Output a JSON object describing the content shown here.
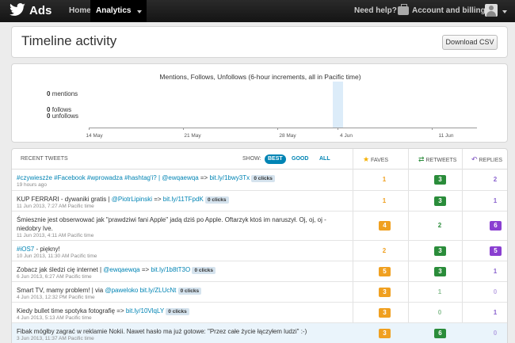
{
  "topbar": {
    "brand": "Ads",
    "nav_home": "Home",
    "nav_analytics": "Analytics",
    "nav_help": "Need help?",
    "nav_account": "Account and billing"
  },
  "header": {
    "title": "Timeline activity",
    "download_label": "Download CSV"
  },
  "chart": {
    "title": "Mentions, Follows, Unfollows (6-hour increments, all in Pacific time)",
    "mentions_count": "0",
    "mentions_label": "mentions",
    "follows_count": "0",
    "follows_label": "follows",
    "unfollows_count": "0",
    "unfollows_label": "unfollows",
    "dates": [
      "14 May",
      "21 May",
      "28 May",
      "4 Jun",
      "11 Jun"
    ]
  },
  "chart_data": {
    "type": "line",
    "title": "Mentions, Follows, Unfollows (6-hour increments, all in Pacific time)",
    "x_ticks": [
      "14 May",
      "21 May",
      "28 May",
      "4 Jun",
      "11 Jun"
    ],
    "series": [
      {
        "name": "mentions",
        "total": 0
      },
      {
        "name": "follows",
        "total": 0
      },
      {
        "name": "unfollows",
        "total": 0
      }
    ],
    "highlighted_range": [
      "3 Jun",
      "4 Jun"
    ]
  },
  "table": {
    "recent_label": "RECENT TWEETS",
    "show_label": "SHOW:",
    "filter_best": "BEST",
    "filter_good": "GOOD",
    "filter_all": "ALL",
    "faves_label": "FAVES",
    "retweets_label": "RETWEETS",
    "replies_label": "REPLIES",
    "rows": [
      {
        "text": "#czywieszże #Facebook #wprowadza #hashtag'i? | ",
        "mention": "@ewqaewqa",
        "arrow": " => ",
        "link": "bit.ly/1bwy3Tx",
        "clicks": "0 clicks",
        "time": "19 hours ago",
        "faves": "1",
        "retweets": "3",
        "replies": "2"
      },
      {
        "text": "KUP FERRARI - dywaniki gratis | ",
        "mention": "@PiotrLipinski",
        "arrow": " => ",
        "link": "bit.ly/11TFpdK",
        "clicks": "0 clicks",
        "time": "11 Jun 2013, 7:27 AM Pacific time",
        "faves": "1",
        "retweets": "3",
        "replies": "1"
      },
      {
        "text": "Śmiesznie jest obserwować jak \"prawdziwi fani Apple\" jadą dziś po Apple. Oftarzyk ktoś im naruszył. Oj, oj, oj - niedobry Ive.",
        "time": "11 Jun 2013, 4:11 AM Pacific time",
        "faves": "4",
        "retweets": "2",
        "replies": "6"
      },
      {
        "text": "",
        "link": "#iOS7",
        "suffix": " - piękny!",
        "time": "10 Jun 2013, 11:30 AM Pacific time",
        "faves": "2",
        "retweets": "3",
        "replies": "5"
      },
      {
        "text": "Zobacz jak śledzi cię internet | ",
        "mention": "@ewqaewqa",
        "arrow": " => ",
        "link": "bit.ly/1b8tT3O",
        "clicks": "0 clicks",
        "time": "6 Jun 2013, 6:27 AM Pacific time",
        "faves": "5",
        "retweets": "3",
        "replies": "1"
      },
      {
        "text": "Smart TV, mamy problem! | via ",
        "mention": "@paweloko",
        "arrow": " ",
        "link": "bit.ly/ZLUcNt",
        "clicks": "0 clicks",
        "time": "4 Jun 2013, 12:32 PM Pacific time",
        "faves": "3",
        "retweets": "1",
        "replies": "0"
      },
      {
        "text": "Kiedy bullet time spotyka fotografię => ",
        "link": "bit.ly/10VlqLY",
        "clicks": "0 clicks",
        "time": "4 Jun 2013, 5:13 AM Pacific time",
        "faves": "3",
        "retweets": "0",
        "replies": "1"
      },
      {
        "text": "Fibak mógłby zagrać w reklamie Nokii. Nawet hasło ma już gotowe: \"Przez całe życie łączyłem ludzi\" :-)",
        "time": "3 Jun 2013, 11:37 AM Pacific time",
        "faves": "3",
        "retweets": "6",
        "replies": "0"
      }
    ]
  },
  "colors": {
    "topbar": "#1c1c1c",
    "link": "#0084b4",
    "faves": "#f0a020",
    "retweets": "#2a8c3a",
    "replies": "#8a3fd1",
    "highlight": "#dcecf9"
  }
}
